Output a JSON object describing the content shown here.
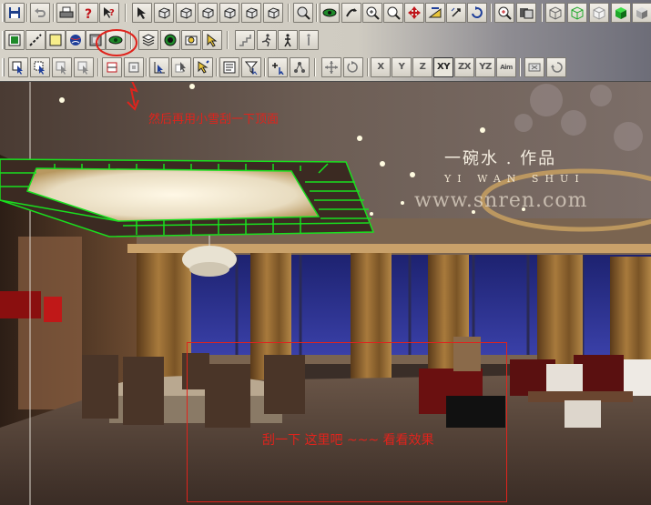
{
  "toolbar": {
    "row1": [
      "save-icon",
      "undo-icon",
      "print-icon",
      "help-icon",
      "context-help-icon",
      "select-object-icon",
      "move-icon",
      "rotate-icon",
      "scale-icon",
      "mirror-icon",
      "array-icon",
      "clone-icon",
      "zoom-extents-icon",
      "view-eye-icon",
      "walk-icon",
      "zoom-in-icon",
      "zoom-icon",
      "pan-icon",
      "orbit-icon",
      "refresh-icon",
      "magnify-icon",
      "render-icon",
      "wire-cube-icon",
      "green-wire-cube-icon",
      "white-cube-icon",
      "solid-green-cube-icon"
    ],
    "row2": [
      "face-select-icon",
      "edge-icon",
      "yellow-square-icon",
      "sphere-icon",
      "material-icon",
      "green-eye-icon",
      "layers-icon",
      "globe-icon",
      "camera-icon",
      "pointer-icon",
      "stairs-icon",
      "running-man-icon",
      "walking-man-icon",
      "figure-icon"
    ],
    "row3": [
      "select-window-icon",
      "select-cross-icon",
      "select-plus-icon",
      "select-minus-icon",
      "align-icon",
      "snap-icon",
      "node-icon",
      "list-icon",
      "filter-icon",
      "add-node-icon",
      "cluster-icon",
      "move-point-icon",
      "rotate-view-icon"
    ],
    "axes": [
      "X",
      "Y",
      "Z",
      "XY",
      "ZX",
      "YZ",
      "Aim"
    ],
    "axis_active": "XY",
    "tail": [
      "erase-icon",
      "undo-view-icon"
    ]
  },
  "viewport": {
    "annotation_top": "然后再用小雪刮一下顶面",
    "annotation_bottom": "刮一下  这里吧 ~~~ 看看效果",
    "watermark_cn": "一碗水 . 作品",
    "watermark_pinyin": "YI  WAN  SHUI",
    "watermark_site": "www.snren.com",
    "colors": {
      "annotation_red": "#e0231c",
      "selection_green": "#19e01e",
      "ceiling_brown": "#3b2a22",
      "window_blue": "#2a2f8a",
      "curtain_brown": "#8a6530"
    }
  }
}
